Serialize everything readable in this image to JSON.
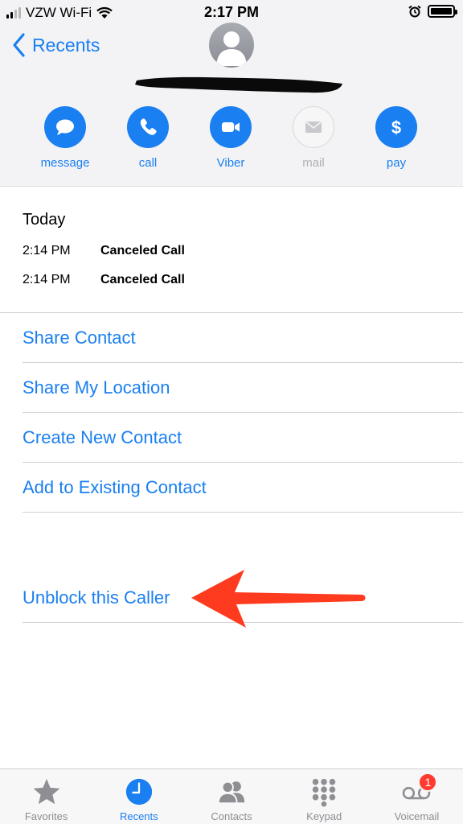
{
  "status_bar": {
    "carrier": "VZW Wi-Fi",
    "time": "2:17 PM"
  },
  "nav": {
    "back_label": "Recents"
  },
  "actions": [
    {
      "icon": "message-icon",
      "label": "message",
      "enabled": true
    },
    {
      "icon": "phone-icon",
      "label": "call",
      "enabled": true
    },
    {
      "icon": "video-icon",
      "label": "Viber",
      "enabled": true
    },
    {
      "icon": "mail-icon",
      "label": "mail",
      "enabled": false
    },
    {
      "icon": "dollar-icon",
      "label": "pay",
      "enabled": true
    }
  ],
  "history": {
    "title": "Today",
    "calls": [
      {
        "time": "2:14 PM",
        "status": "Canceled Call"
      },
      {
        "time": "2:14 PM",
        "status": "Canceled Call"
      }
    ]
  },
  "menu": {
    "share_contact": "Share Contact",
    "share_location": "Share My Location",
    "create_contact": "Create New Contact",
    "add_existing": "Add to Existing Contact",
    "unblock": "Unblock this Caller"
  },
  "tabs": [
    {
      "icon": "star-icon",
      "label": "Favorites",
      "active": false
    },
    {
      "icon": "clock-icon",
      "label": "Recents",
      "active": true
    },
    {
      "icon": "contacts-icon",
      "label": "Contacts",
      "active": false
    },
    {
      "icon": "keypad-icon",
      "label": "Keypad",
      "active": false
    },
    {
      "icon": "voicemail-icon",
      "label": "Voicemail",
      "active": false,
      "badge": "1"
    }
  ],
  "colors": {
    "accent": "#1a7ff0",
    "header_bg": "#f3f3f5",
    "badge": "#ff3b30",
    "arrow": "#ff3b1f"
  }
}
